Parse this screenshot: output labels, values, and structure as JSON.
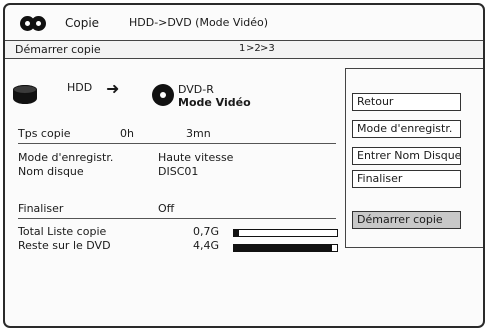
{
  "header": {
    "app_title": "Copie",
    "mode_title": "HDD->DVD (Mode Vidéo)"
  },
  "stepbar": {
    "label": "Démarrer copie",
    "steps": [
      "1",
      ">2",
      ">3"
    ]
  },
  "transfer": {
    "source": "HDD",
    "destination": "DVD-R",
    "destination_mode": "Mode Vidéo"
  },
  "details": {
    "copy_time_label": "Tps copie",
    "copy_time_hours": "0h",
    "copy_time_minutes": "3mn",
    "record_mode_label": "Mode d'enregistr.",
    "record_mode_value": "Haute vitesse",
    "disc_name_label": "Nom disque",
    "disc_name_value": "DISC01",
    "finalize_label": "Finaliser",
    "finalize_value": "Off"
  },
  "capacity": {
    "total_label": "Total Liste copie",
    "total_value": "0,7G",
    "total_fraction": 0.05,
    "remaining_label": "Reste sur le DVD",
    "remaining_value": "4,4G",
    "remaining_fraction": 0.95
  },
  "menu": {
    "items": [
      "Retour",
      "Mode d'enregistr.",
      "Entrer Nom Disque",
      "Finaliser",
      "Démarrer copie"
    ],
    "selected": "Démarrer copie"
  },
  "icons": [
    "disc-logo-icon",
    "hdd-icon",
    "arrow-right-icon",
    "dvd-disc-icon"
  ]
}
